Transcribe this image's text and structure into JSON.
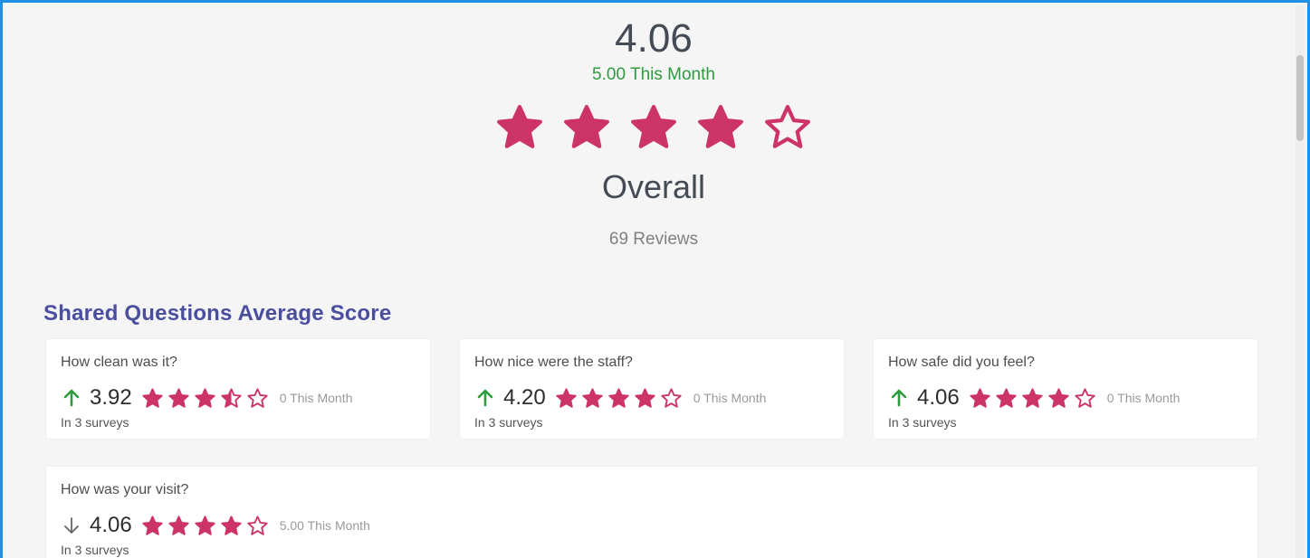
{
  "summary": {
    "score": "4.06",
    "month": "5.00 This Month",
    "label": "Overall",
    "reviews": "69 Reviews",
    "stars": [
      "full",
      "full",
      "full",
      "full",
      "empty"
    ]
  },
  "section": {
    "title": "Shared Questions Average Score"
  },
  "colors": {
    "star": "#cc3366",
    "up_arrow": "#2e9b3e",
    "down_arrow": "#666666",
    "title": "#4a4e9e"
  },
  "cards": [
    {
      "question": "How clean was it?",
      "trend": "up",
      "value": "3.92",
      "stars": [
        "full",
        "full",
        "full",
        "half",
        "empty"
      ],
      "month": "0 This Month",
      "surveys": "In 3 surveys"
    },
    {
      "question": "How nice were the staff?",
      "trend": "up",
      "value": "4.20",
      "stars": [
        "full",
        "full",
        "full",
        "full",
        "empty"
      ],
      "month": "0 This Month",
      "surveys": "In 3 surveys"
    },
    {
      "question": "How safe did you feel?",
      "trend": "up",
      "value": "4.06",
      "stars": [
        "full",
        "full",
        "full",
        "full",
        "empty"
      ],
      "month": "0 This Month",
      "surveys": "In 3 surveys"
    },
    {
      "question": "How was your visit?",
      "trend": "down",
      "value": "4.06",
      "stars": [
        "full",
        "full",
        "full",
        "full",
        "empty"
      ],
      "month": "5.00 This Month",
      "surveys": "In 3 surveys"
    }
  ]
}
